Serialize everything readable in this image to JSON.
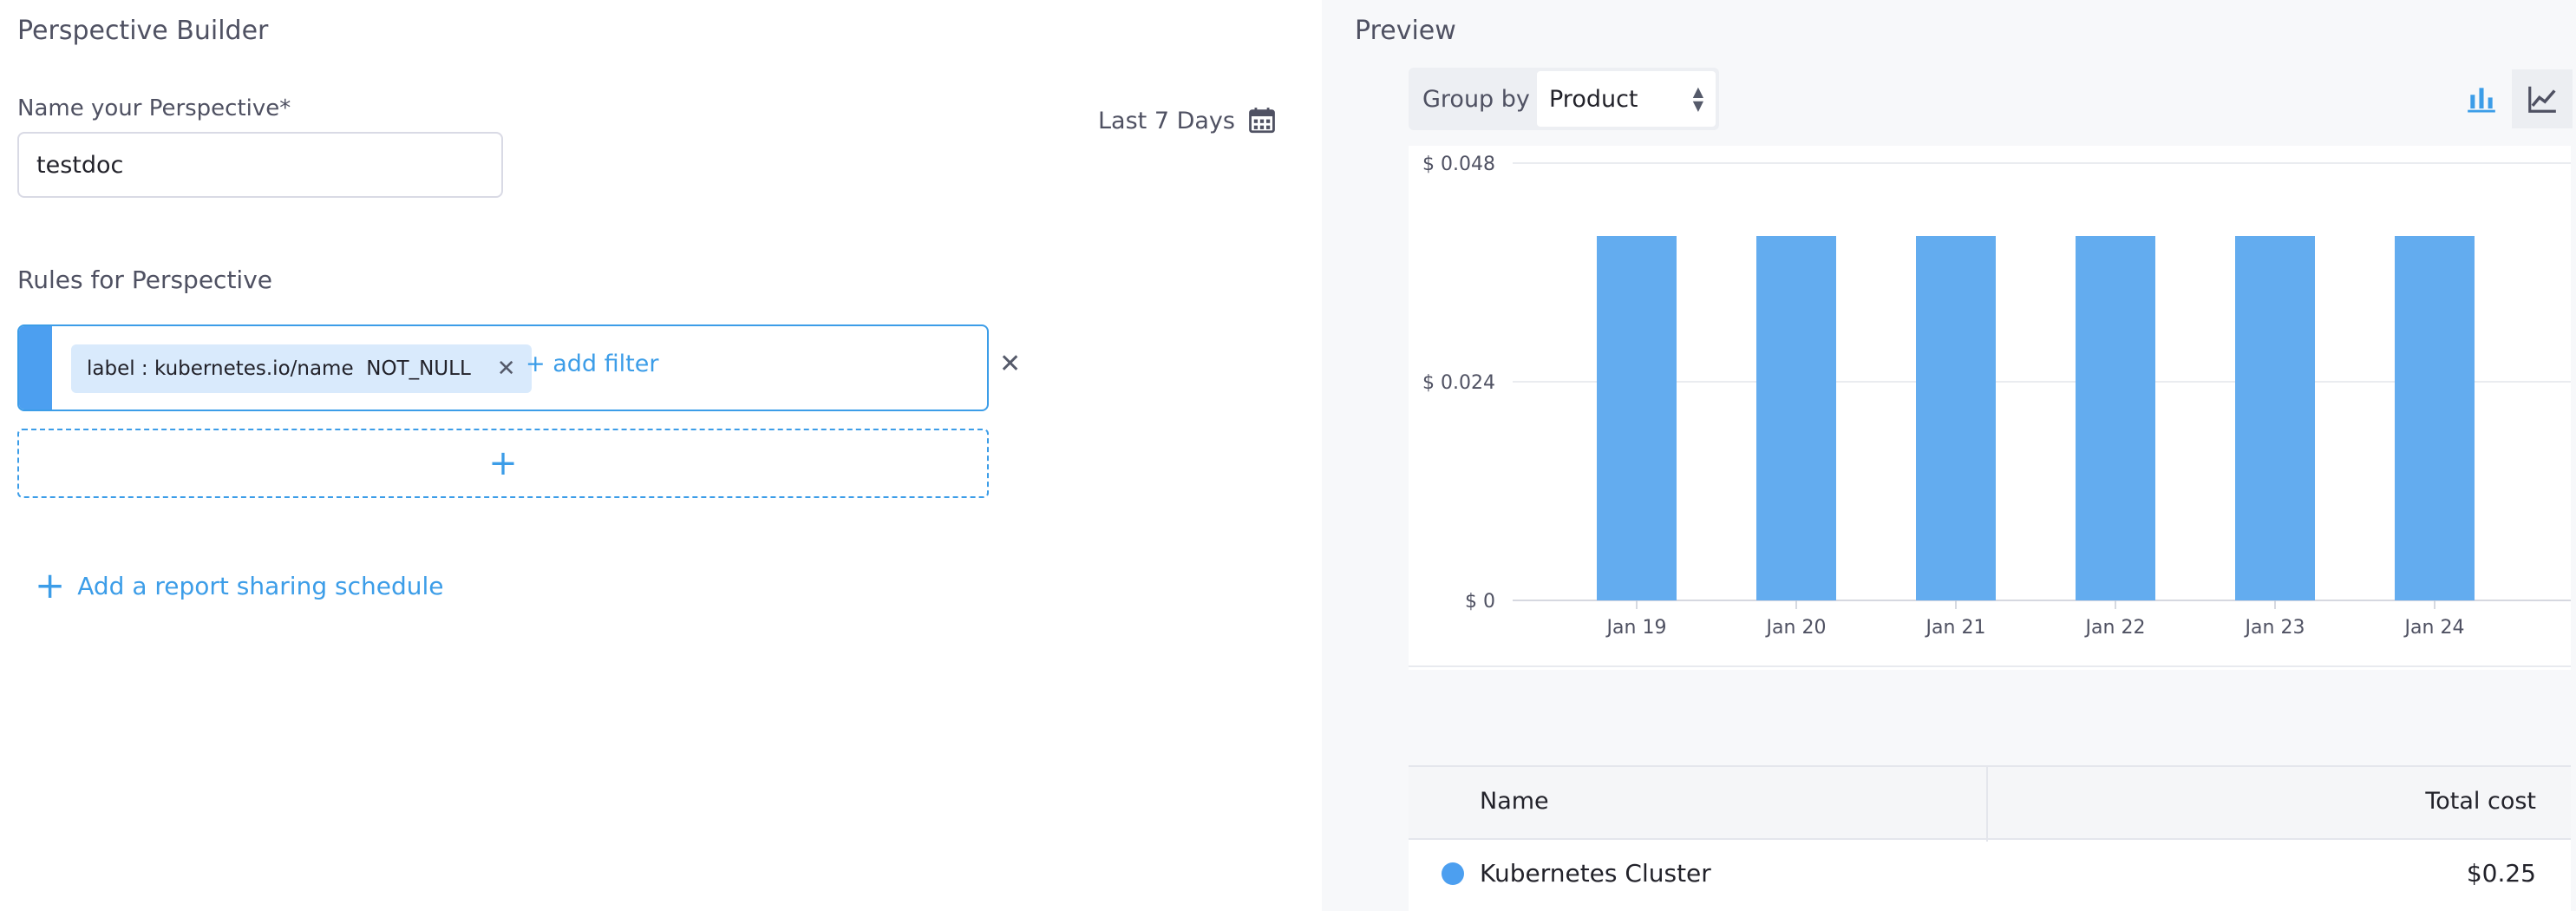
{
  "builder": {
    "title": "Perspective Builder",
    "name_label": "Name your Perspective*",
    "name_value": "testdoc",
    "date_range": "Last 7 Days",
    "rules_title": "Rules for Perspective",
    "filter_chip": "label : kubernetes.io/name  NOT_NULL",
    "add_filter": "+ add filter",
    "add_rule": "+",
    "add_schedule": "Add a report sharing schedule"
  },
  "preview": {
    "title": "Preview",
    "group_by_label": "Group by",
    "group_by_value": "Product",
    "chart_types": [
      "bar-chart-icon",
      "line-chart-icon"
    ]
  },
  "chart_data": {
    "type": "bar",
    "categories": [
      "Jan 19",
      "Jan 20",
      "Jan 21",
      "Jan 22",
      "Jan 23",
      "Jan 24"
    ],
    "values": [
      0.04,
      0.04,
      0.04,
      0.04,
      0.04,
      0.04
    ],
    "ylim": [
      0,
      0.048
    ],
    "yticks": [
      "$ 0",
      "$ 0.024",
      "$ 0.048"
    ],
    "ytick_values": [
      0,
      0.024,
      0.048
    ],
    "grid": true,
    "bar_color": "#63acef"
  },
  "table": {
    "col_name": "Name",
    "col_cost": "Total cost",
    "rows": [
      {
        "name": "Kubernetes Cluster",
        "cost": "$0.25",
        "color": "#4c9ff0"
      }
    ]
  },
  "colors": {
    "accent": "#3c9de8",
    "panel_bg": "#f7f8fa"
  }
}
